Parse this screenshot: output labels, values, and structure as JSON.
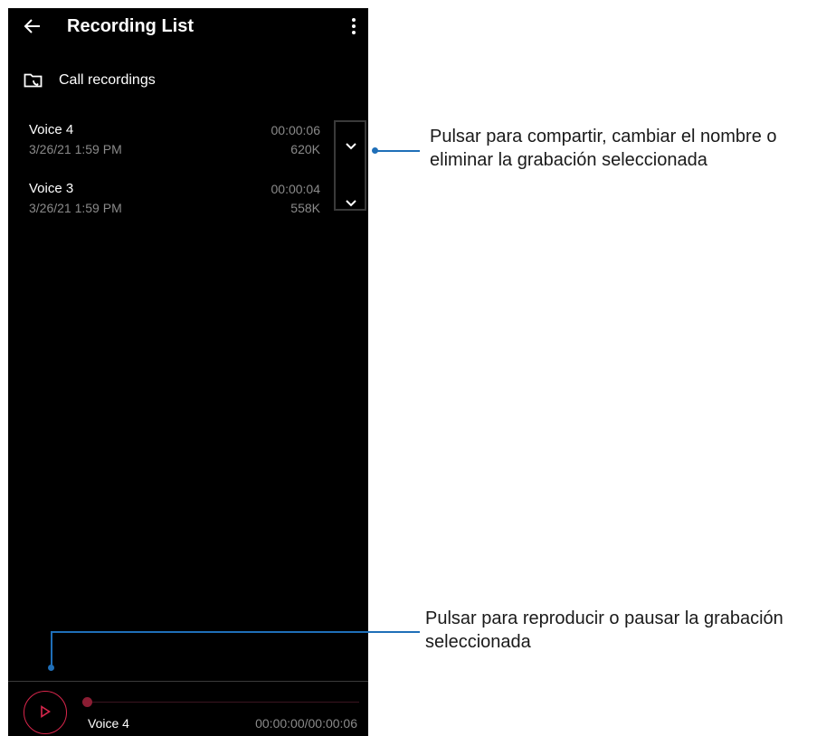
{
  "app": {
    "title": "Recording List",
    "folder_label": "Call recordings"
  },
  "recordings": [
    {
      "name": "Voice 4",
      "date": "3/26/21 1:59 PM",
      "duration": "00:00:06",
      "size": "620K"
    },
    {
      "name": "Voice 3",
      "date": "3/26/21 1:59 PM",
      "duration": "00:00:04",
      "size": "558K"
    }
  ],
  "player": {
    "name": "Voice 4",
    "time": "00:00:00/00:00:06",
    "progress": 0,
    "accent_color": "#d9264c"
  },
  "annotations": {
    "share": [
      "Pulsar para compartir, cambiar el nombre o",
      "eliminar la grabación seleccionada"
    ],
    "play": [
      "Pulsar para reproducir o pausar la grabación",
      "seleccionada"
    ],
    "line_color": "#1f6fb8"
  },
  "icons": [
    "back-arrow-icon",
    "more-vert-icon",
    "folder-call-icon",
    "chevron-down-icon",
    "play-icon"
  ]
}
